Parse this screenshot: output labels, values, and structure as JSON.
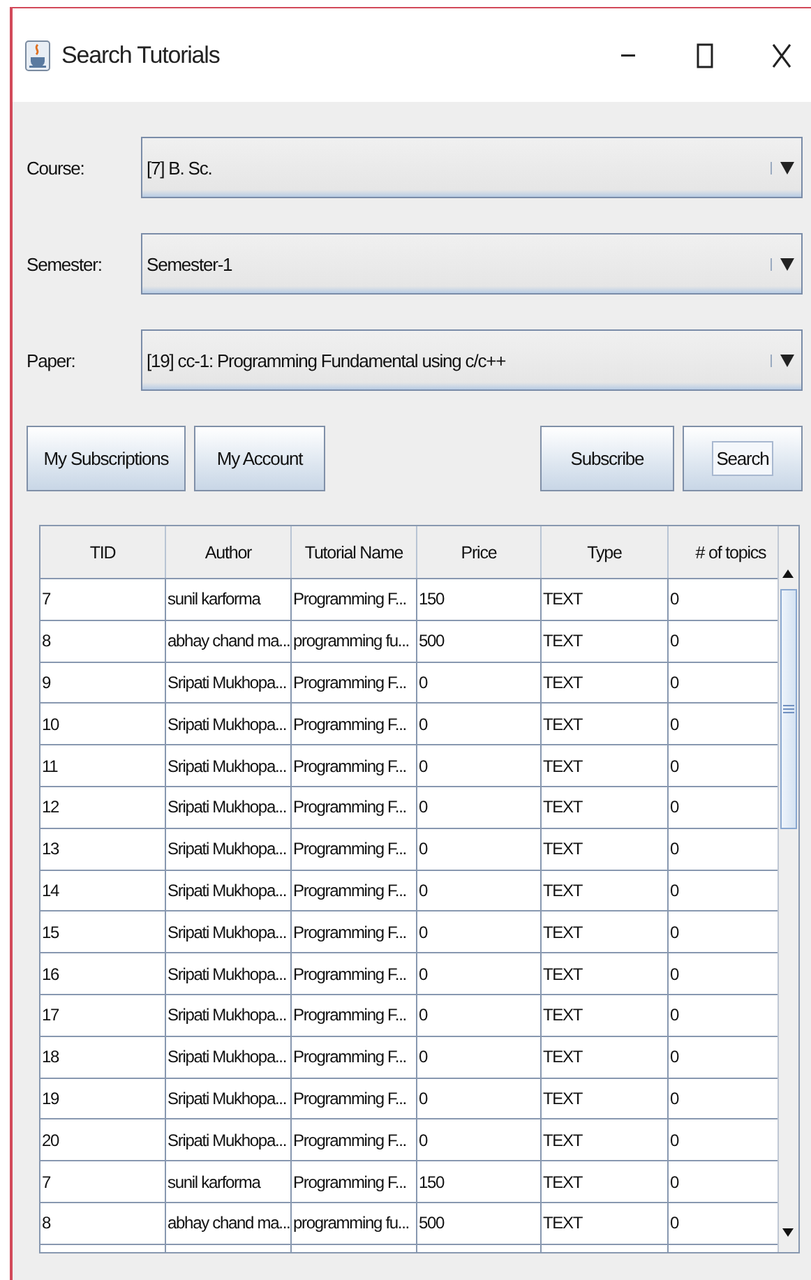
{
  "window": {
    "title": "Search Tutorials"
  },
  "fields": [
    {
      "label": "Course:",
      "value": "[7] B. Sc."
    },
    {
      "label": "Semester:",
      "value": "Semester-1"
    },
    {
      "label": "Paper:",
      "value": "[19] cc-1: Programming Fundamental using c/c++"
    }
  ],
  "buttons_left": [
    "My Subscriptions",
    "My Account"
  ],
  "buttons_right": [
    {
      "label": "Subscribe",
      "focused": false
    },
    {
      "label": "Search",
      "focused": true
    }
  ],
  "table": {
    "columns": [
      "TID",
      "Author",
      "Tutorial Name",
      "Price",
      "Type",
      "# of topics"
    ],
    "rows": [
      [
        "7",
        "sunil karforma",
        "Programming F...",
        "150",
        "TEXT",
        "0"
      ],
      [
        "8",
        "abhay chand ma...",
        "programming fu...",
        "500",
        "TEXT",
        "0"
      ],
      [
        "9",
        "Sripati Mukhopa...",
        "Programming F...",
        "0",
        "TEXT",
        "0"
      ],
      [
        "10",
        "Sripati Mukhopa...",
        "Programming F...",
        "0",
        "TEXT",
        "0"
      ],
      [
        "11",
        "Sripati Mukhopa...",
        "Programming F...",
        "0",
        "TEXT",
        "0"
      ],
      [
        "12",
        "Sripati Mukhopa...",
        "Programming F...",
        "0",
        "TEXT",
        "0"
      ],
      [
        "13",
        "Sripati Mukhopa...",
        "Programming F...",
        "0",
        "TEXT",
        "0"
      ],
      [
        "14",
        "Sripati Mukhopa...",
        "Programming F...",
        "0",
        "TEXT",
        "0"
      ],
      [
        "15",
        "Sripati Mukhopa...",
        "Programming F...",
        "0",
        "TEXT",
        "0"
      ],
      [
        "16",
        "Sripati Mukhopa...",
        "Programming F...",
        "0",
        "TEXT",
        "0"
      ],
      [
        "17",
        "Sripati Mukhopa...",
        "Programming F...",
        "0",
        "TEXT",
        "0"
      ],
      [
        "18",
        "Sripati Mukhopa...",
        "Programming F...",
        "0",
        "TEXT",
        "0"
      ],
      [
        "19",
        "Sripati Mukhopa...",
        "Programming F...",
        "0",
        "TEXT",
        "0"
      ],
      [
        "20",
        "Sripati Mukhopa...",
        "Programming F...",
        "0",
        "TEXT",
        "0"
      ],
      [
        "7",
        "sunil karforma",
        "Programming F...",
        "150",
        "TEXT",
        "0"
      ],
      [
        "8",
        "abhay chand ma...",
        "programming fu...",
        "500",
        "TEXT",
        "0"
      ]
    ]
  }
}
